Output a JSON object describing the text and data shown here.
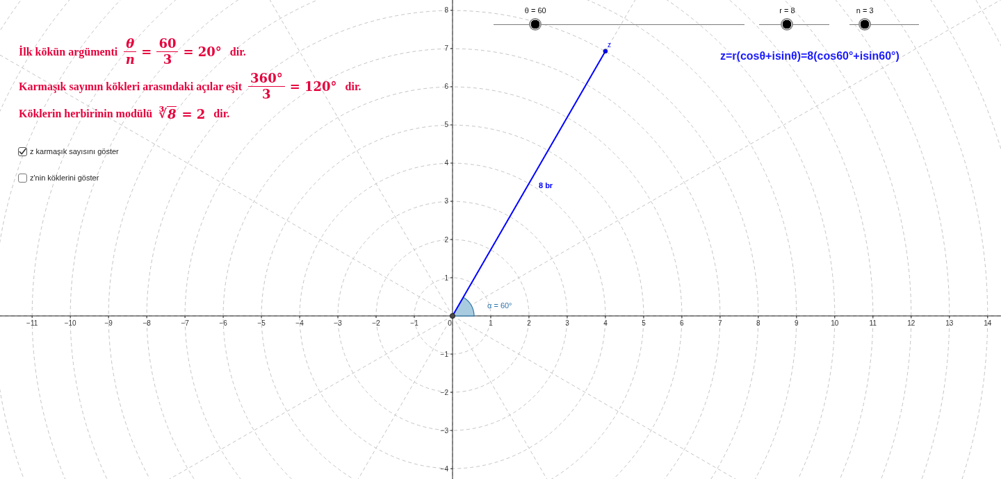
{
  "sliders": [
    {
      "label": "θ = 60",
      "level": 0.167
    },
    {
      "label": "r = 8",
      "level": 0.4
    },
    {
      "label": "n = 3",
      "level": 0.222
    }
  ],
  "info_lines": [
    {
      "segments": [
        {
          "kind": "text",
          "text": "İlk kökün argümenti"
        },
        {
          "kind": "frac",
          "num": "θ",
          "den": "n",
          "italic": true
        },
        {
          "kind": "math",
          "text": "="
        },
        {
          "kind": "frac",
          "num": "60",
          "den": "3",
          "italic": false
        },
        {
          "kind": "math",
          "text": "= 20°"
        },
        {
          "kind": "text",
          "text": "dir."
        }
      ]
    },
    {
      "segments": [
        {
          "kind": "text",
          "text": "Karmaşık sayının kökleri arasındaki açılar eşit"
        },
        {
          "kind": "frac",
          "num": "360°",
          "den": "3",
          "italic": false
        },
        {
          "kind": "math",
          "text": "= 120°"
        },
        {
          "kind": "text",
          "text": "dir."
        }
      ]
    },
    {
      "segments": [
        {
          "kind": "text",
          "text": "Köklerin herbirinin modülü"
        },
        {
          "kind": "root",
          "sign": "∛",
          "radicand": "8"
        },
        {
          "kind": "math",
          "text": "= 2"
        },
        {
          "kind": "text",
          "text": "dir."
        }
      ]
    }
  ],
  "formula": "z=r(cosθ+isinθ)=8(cos60°+isin60°)",
  "checkboxes": [
    {
      "label": "z karmaşık sayısını göster",
      "checked": true
    },
    {
      "label": "z'nin köklerini göster",
      "checked": false
    }
  ],
  "graph": {
    "segment_label": "8 br",
    "angle_label": "α = 60°",
    "chart_data": {
      "type": "line",
      "x": [
        0,
        4
      ],
      "series": [
        {
          "name": "z",
          "color": "#0000ff",
          "marker": "circle",
          "values": [
            0,
            6.93
          ]
        }
      ],
      "xlim": [
        -11.84,
        14.35
      ],
      "ylim": [
        -4.27,
        8.27
      ],
      "xticks": [
        {
          "value": -11,
          "label": "−11"
        },
        {
          "value": -10,
          "label": "−10"
        },
        {
          "value": -9,
          "label": "−9"
        },
        {
          "value": -8,
          "label": "−8"
        },
        {
          "value": -7,
          "label": "−7"
        },
        {
          "value": -6,
          "label": "−6"
        },
        {
          "value": -5,
          "label": "−5"
        },
        {
          "value": -4,
          "label": "−4"
        },
        {
          "value": -3,
          "label": "−3"
        },
        {
          "value": -2,
          "label": "−2"
        },
        {
          "value": -1,
          "label": "−1"
        },
        0,
        1,
        2,
        3,
        4,
        5,
        6,
        7,
        8,
        9,
        10,
        11,
        12,
        13,
        14
      ],
      "yticks": [
        {
          "value": -4,
          "label": "−4"
        },
        {
          "value": -3,
          "label": "−3"
        },
        {
          "value": -2,
          "label": "−2"
        },
        {
          "value": -1,
          "label": "−1"
        },
        1,
        2,
        3,
        4,
        5,
        6,
        7,
        8
      ]
    }
  }
}
